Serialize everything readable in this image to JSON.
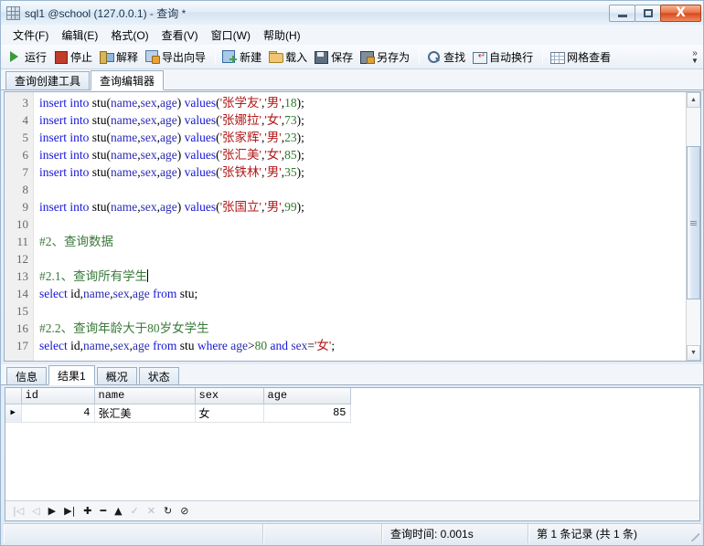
{
  "window": {
    "title": "sql1 @school (127.0.0.1) - 查询 *",
    "icon": "table-window-icon",
    "buttons": {
      "minimize": "–",
      "maximize": "□",
      "close": "X"
    }
  },
  "menubar": {
    "items": [
      {
        "name": "file",
        "label": "文件(F)"
      },
      {
        "name": "edit",
        "label": "编辑(E)"
      },
      {
        "name": "format",
        "label": "格式(O)"
      },
      {
        "name": "view",
        "label": "查看(V)"
      },
      {
        "name": "window",
        "label": "窗口(W)"
      },
      {
        "name": "help",
        "label": "帮助(H)"
      }
    ]
  },
  "toolbar": {
    "items": [
      {
        "name": "run",
        "label": "运行",
        "icon": "play-icon"
      },
      {
        "name": "stop",
        "label": "停止",
        "icon": "stop-square-icon"
      },
      {
        "name": "explain",
        "label": "解释",
        "icon": "explain-icon"
      },
      {
        "name": "export-wizard",
        "label": "导出向导",
        "icon": "export-icon"
      },
      {
        "name": "new",
        "label": "新建",
        "icon": "new-document-icon"
      },
      {
        "name": "load",
        "label": "载入",
        "icon": "folder-open-icon"
      },
      {
        "name": "save",
        "label": "保存",
        "icon": "floppy-disk-icon"
      },
      {
        "name": "save-as",
        "label": "另存为",
        "icon": "floppy-disk-as-icon"
      },
      {
        "name": "find",
        "label": "查找",
        "icon": "search-icon"
      },
      {
        "name": "word-wrap",
        "label": "自动换行",
        "icon": "word-wrap-icon"
      },
      {
        "name": "grid-view",
        "label": "网格查看",
        "icon": "grid-icon"
      }
    ],
    "overflow": "»"
  },
  "editor_tabs": [
    {
      "name": "query-builder",
      "label": "查询创建工具",
      "active": false
    },
    {
      "name": "query-editor",
      "label": "查询编辑器",
      "active": true
    }
  ],
  "editor": {
    "first_visible_line": 3,
    "lines": [
      {
        "no": "3",
        "tokens": [
          {
            "t": "kw",
            "v": "insert into "
          },
          {
            "t": "id",
            "v": "stu"
          },
          {
            "t": "pun",
            "v": "("
          },
          {
            "t": "nm",
            "v": "name"
          },
          {
            "t": "pun",
            "v": ","
          },
          {
            "t": "nm",
            "v": "sex"
          },
          {
            "t": "pun",
            "v": ","
          },
          {
            "t": "nm",
            "v": "age"
          },
          {
            "t": "pun",
            "v": ") "
          },
          {
            "t": "kw",
            "v": "values"
          },
          {
            "t": "pun",
            "v": "("
          },
          {
            "t": "str",
            "v": "'张学友'"
          },
          {
            "t": "pun",
            "v": ","
          },
          {
            "t": "str",
            "v": "'男'"
          },
          {
            "t": "pun",
            "v": ","
          },
          {
            "t": "num",
            "v": "18"
          },
          {
            "t": "pun",
            "v": ");"
          }
        ]
      },
      {
        "no": "4",
        "tokens": [
          {
            "t": "kw",
            "v": "insert into "
          },
          {
            "t": "id",
            "v": "stu"
          },
          {
            "t": "pun",
            "v": "("
          },
          {
            "t": "nm",
            "v": "name"
          },
          {
            "t": "pun",
            "v": ","
          },
          {
            "t": "nm",
            "v": "sex"
          },
          {
            "t": "pun",
            "v": ","
          },
          {
            "t": "nm",
            "v": "age"
          },
          {
            "t": "pun",
            "v": ") "
          },
          {
            "t": "kw",
            "v": "values"
          },
          {
            "t": "pun",
            "v": "("
          },
          {
            "t": "str",
            "v": "'张娜拉'"
          },
          {
            "t": "pun",
            "v": ","
          },
          {
            "t": "str",
            "v": "'女'"
          },
          {
            "t": "pun",
            "v": ","
          },
          {
            "t": "num",
            "v": "73"
          },
          {
            "t": "pun",
            "v": ");"
          }
        ]
      },
      {
        "no": "5",
        "tokens": [
          {
            "t": "kw",
            "v": "insert into "
          },
          {
            "t": "id",
            "v": "stu"
          },
          {
            "t": "pun",
            "v": "("
          },
          {
            "t": "nm",
            "v": "name"
          },
          {
            "t": "pun",
            "v": ","
          },
          {
            "t": "nm",
            "v": "sex"
          },
          {
            "t": "pun",
            "v": ","
          },
          {
            "t": "nm",
            "v": "age"
          },
          {
            "t": "pun",
            "v": ") "
          },
          {
            "t": "kw",
            "v": "values"
          },
          {
            "t": "pun",
            "v": "("
          },
          {
            "t": "str",
            "v": "'张家辉'"
          },
          {
            "t": "pun",
            "v": ","
          },
          {
            "t": "str",
            "v": "'男'"
          },
          {
            "t": "pun",
            "v": ","
          },
          {
            "t": "num",
            "v": "23"
          },
          {
            "t": "pun",
            "v": ");"
          }
        ]
      },
      {
        "no": "6",
        "tokens": [
          {
            "t": "kw",
            "v": "insert into "
          },
          {
            "t": "id",
            "v": "stu"
          },
          {
            "t": "pun",
            "v": "("
          },
          {
            "t": "nm",
            "v": "name"
          },
          {
            "t": "pun",
            "v": ","
          },
          {
            "t": "nm",
            "v": "sex"
          },
          {
            "t": "pun",
            "v": ","
          },
          {
            "t": "nm",
            "v": "age"
          },
          {
            "t": "pun",
            "v": ") "
          },
          {
            "t": "kw",
            "v": "values"
          },
          {
            "t": "pun",
            "v": "("
          },
          {
            "t": "str",
            "v": "'张汇美'"
          },
          {
            "t": "pun",
            "v": ","
          },
          {
            "t": "str",
            "v": "'女'"
          },
          {
            "t": "pun",
            "v": ","
          },
          {
            "t": "num",
            "v": "85"
          },
          {
            "t": "pun",
            "v": ");"
          }
        ]
      },
      {
        "no": "7",
        "tokens": [
          {
            "t": "kw",
            "v": "insert into "
          },
          {
            "t": "id",
            "v": "stu"
          },
          {
            "t": "pun",
            "v": "("
          },
          {
            "t": "nm",
            "v": "name"
          },
          {
            "t": "pun",
            "v": ","
          },
          {
            "t": "nm",
            "v": "sex"
          },
          {
            "t": "pun",
            "v": ","
          },
          {
            "t": "nm",
            "v": "age"
          },
          {
            "t": "pun",
            "v": ") "
          },
          {
            "t": "kw",
            "v": "values"
          },
          {
            "t": "pun",
            "v": "("
          },
          {
            "t": "str",
            "v": "'张铁林'"
          },
          {
            "t": "pun",
            "v": ","
          },
          {
            "t": "str",
            "v": "'男'"
          },
          {
            "t": "pun",
            "v": ","
          },
          {
            "t": "num",
            "v": "35"
          },
          {
            "t": "pun",
            "v": ");"
          }
        ]
      },
      {
        "no": "8",
        "tokens": []
      },
      {
        "no": "9",
        "tokens": [
          {
            "t": "kw",
            "v": "insert into "
          },
          {
            "t": "id",
            "v": "stu"
          },
          {
            "t": "pun",
            "v": "("
          },
          {
            "t": "nm",
            "v": "name"
          },
          {
            "t": "pun",
            "v": ","
          },
          {
            "t": "nm",
            "v": "sex"
          },
          {
            "t": "pun",
            "v": ","
          },
          {
            "t": "nm",
            "v": "age"
          },
          {
            "t": "pun",
            "v": ") "
          },
          {
            "t": "kw",
            "v": "values"
          },
          {
            "t": "pun",
            "v": "("
          },
          {
            "t": "str",
            "v": "'张国立'"
          },
          {
            "t": "pun",
            "v": ","
          },
          {
            "t": "str",
            "v": "'男'"
          },
          {
            "t": "pun",
            "v": ","
          },
          {
            "t": "num",
            "v": "99"
          },
          {
            "t": "pun",
            "v": ");"
          }
        ]
      },
      {
        "no": "10",
        "tokens": []
      },
      {
        "no": "11",
        "tokens": [
          {
            "t": "cmt",
            "v": "#2、查询数据"
          }
        ]
      },
      {
        "no": "12",
        "tokens": []
      },
      {
        "no": "13",
        "tokens": [
          {
            "t": "cmt",
            "v": "#2.1、查询所有学生"
          }
        ],
        "caret": true
      },
      {
        "no": "14",
        "tokens": [
          {
            "t": "kw",
            "v": "select "
          },
          {
            "t": "id",
            "v": "id"
          },
          {
            "t": "pun",
            "v": ","
          },
          {
            "t": "nm",
            "v": "name"
          },
          {
            "t": "pun",
            "v": ","
          },
          {
            "t": "nm",
            "v": "sex"
          },
          {
            "t": "pun",
            "v": ","
          },
          {
            "t": "nm",
            "v": "age"
          },
          {
            "t": "pun",
            "v": " "
          },
          {
            "t": "kw",
            "v": "from"
          },
          {
            "t": "pun",
            "v": " "
          },
          {
            "t": "id",
            "v": "stu"
          },
          {
            "t": "pun",
            "v": ";"
          }
        ]
      },
      {
        "no": "15",
        "tokens": []
      },
      {
        "no": "16",
        "tokens": [
          {
            "t": "cmt",
            "v": "#2.2、查询年龄大于80岁女学生"
          }
        ]
      },
      {
        "no": "17",
        "tokens": [
          {
            "t": "kw",
            "v": "select "
          },
          {
            "t": "id",
            "v": "id"
          },
          {
            "t": "pun",
            "v": ","
          },
          {
            "t": "nm",
            "v": "name"
          },
          {
            "t": "pun",
            "v": ","
          },
          {
            "t": "nm",
            "v": "sex"
          },
          {
            "t": "pun",
            "v": ","
          },
          {
            "t": "nm",
            "v": "age"
          },
          {
            "t": "pun",
            "v": " "
          },
          {
            "t": "kw",
            "v": "from"
          },
          {
            "t": "pun",
            "v": " "
          },
          {
            "t": "id",
            "v": "stu"
          },
          {
            "t": "pun",
            "v": " "
          },
          {
            "t": "kw",
            "v": "where"
          },
          {
            "t": "pun",
            "v": " "
          },
          {
            "t": "nm",
            "v": "age"
          },
          {
            "t": "pun",
            "v": ">"
          },
          {
            "t": "num",
            "v": "80"
          },
          {
            "t": "pun",
            "v": " "
          },
          {
            "t": "kw",
            "v": "and"
          },
          {
            "t": "pun",
            "v": " "
          },
          {
            "t": "nm",
            "v": "sex"
          },
          {
            "t": "pun",
            "v": "="
          },
          {
            "t": "str",
            "v": "'女'"
          },
          {
            "t": "pun",
            "v": ";"
          }
        ]
      }
    ],
    "scrollbar": {
      "up": "▲",
      "down": "▼"
    }
  },
  "result_tabs": [
    {
      "name": "info",
      "label": "信息",
      "active": false
    },
    {
      "name": "result1",
      "label": "结果1",
      "active": true
    },
    {
      "name": "profile",
      "label": "概况",
      "active": false
    },
    {
      "name": "status",
      "label": "状态",
      "active": false
    }
  ],
  "result_grid": {
    "columns": [
      "id",
      "name",
      "sex",
      "age"
    ],
    "rows": [
      {
        "marker": "▶",
        "id": "4",
        "name": "张汇美",
        "sex": "女",
        "age": "85"
      }
    ]
  },
  "record_nav": [
    {
      "name": "first-record",
      "glyph": "|◁",
      "enabled": false
    },
    {
      "name": "previous-record",
      "glyph": "◁",
      "enabled": false
    },
    {
      "name": "next-record",
      "glyph": "▶",
      "enabled": true
    },
    {
      "name": "last-record",
      "glyph": "▶|",
      "enabled": true
    },
    {
      "name": "add-record",
      "glyph": "✚",
      "enabled": true
    },
    {
      "name": "delete-record",
      "glyph": "━",
      "enabled": true
    },
    {
      "name": "edit-record",
      "glyph": "▲",
      "enabled": true
    },
    {
      "name": "confirm-record",
      "glyph": "✓",
      "enabled": false
    },
    {
      "name": "cancel-record",
      "glyph": "✕",
      "enabled": false
    },
    {
      "name": "refresh-record",
      "glyph": "↻",
      "enabled": true
    },
    {
      "name": "stop-record",
      "glyph": "⊘",
      "enabled": true
    }
  ],
  "statusbar": {
    "query_time": "查询时间: 0.001s",
    "record_info": "第 1 条记录 (共 1 条)"
  },
  "colors": {
    "keyword": "#1515d8",
    "identifier": "#2b2bb5",
    "string": "#b01818",
    "number": "#2d7a2d",
    "comment": "#3a7a3a",
    "close_button": "#d9491f",
    "run_icon": "#3a9b3a",
    "stop_icon": "#c23b2b"
  }
}
